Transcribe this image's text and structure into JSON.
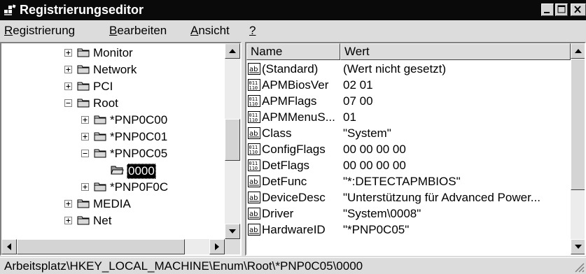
{
  "window": {
    "title": "Registrierungseditor"
  },
  "menu": {
    "items": [
      {
        "accel": "R",
        "rest": "egistrierung"
      },
      {
        "accel": "B",
        "rest": "earbeiten"
      },
      {
        "accel": "A",
        "rest": "nsicht"
      },
      {
        "accel": "?",
        "rest": ""
      }
    ]
  },
  "tree": {
    "nodes": [
      {
        "label": "Monitor",
        "expander": "+",
        "selected": false
      },
      {
        "label": "Network",
        "expander": "+",
        "selected": false
      },
      {
        "label": "PCI",
        "expander": "+",
        "selected": false
      },
      {
        "label": "Root",
        "expander": "-",
        "selected": false
      },
      {
        "label": "*PNP0C00",
        "expander": "+",
        "selected": false
      },
      {
        "label": "*PNP0C01",
        "expander": "+",
        "selected": false
      },
      {
        "label": "*PNP0C05",
        "expander": "-",
        "selected": false
      },
      {
        "label": "0000",
        "expander": "",
        "selected": true
      },
      {
        "label": "*PNP0F0C",
        "expander": "+",
        "selected": false
      },
      {
        "label": "MEDIA",
        "expander": "+",
        "selected": false
      },
      {
        "label": "Net",
        "expander": "+",
        "selected": false
      }
    ]
  },
  "list": {
    "headers": {
      "name": "Name",
      "value": "Wert"
    },
    "rows": [
      {
        "icon": "string-value-icon",
        "name": "(Standard)",
        "value": "(Wert nicht gesetzt)"
      },
      {
        "icon": "binary-value-icon",
        "name": "APMBiosVer",
        "value": "02 01"
      },
      {
        "icon": "binary-value-icon",
        "name": "APMFlags",
        "value": "07 00"
      },
      {
        "icon": "binary-value-icon",
        "name": "APMMenuS...",
        "value": "01"
      },
      {
        "icon": "string-value-icon",
        "name": "Class",
        "value": "\"System\""
      },
      {
        "icon": "binary-value-icon",
        "name": "ConfigFlags",
        "value": "00 00 00 00"
      },
      {
        "icon": "binary-value-icon",
        "name": "DetFlags",
        "value": "00 00 00 00"
      },
      {
        "icon": "string-value-icon",
        "name": "DetFunc",
        "value": "\"*:DETECTAPMBIOS\""
      },
      {
        "icon": "string-value-icon",
        "name": "DeviceDesc",
        "value": "\"Unterstützung für Advanced Power..."
      },
      {
        "icon": "string-value-icon",
        "name": "Driver",
        "value": "\"System\\0008\""
      },
      {
        "icon": "string-value-icon",
        "name": "HardwareID",
        "value": "\"*PNP0C05\""
      }
    ]
  },
  "status": {
    "path": "Arbeitsplatz\\HKEY_LOCAL_MACHINE\\Enum\\Root\\*PNP0C05\\0000"
  }
}
